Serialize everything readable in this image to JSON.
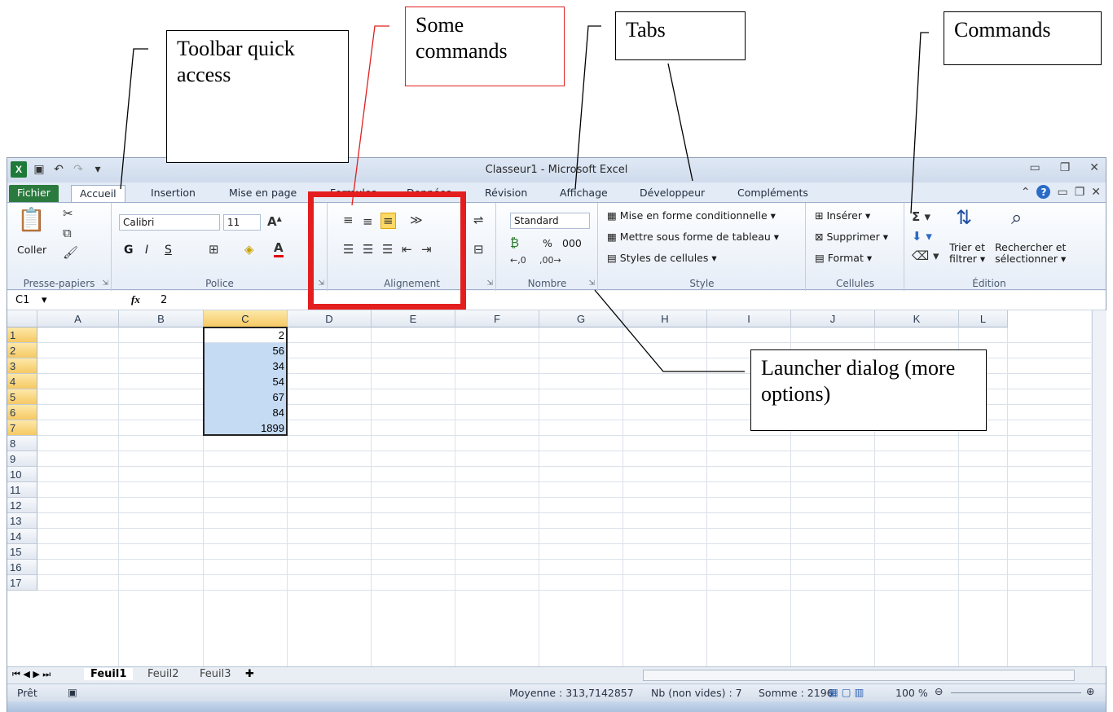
{
  "callouts": {
    "qat": "Toolbar quick access",
    "some_commands": "Some commands",
    "tabs": "Tabs",
    "commands": "Commands",
    "launcher": "Launcher dialog (more options)"
  },
  "titlebar": {
    "title": "Classeur1 - Microsoft Excel"
  },
  "tabs": [
    "Fichier",
    "Accueil",
    "Insertion",
    "Mise en page",
    "Formules",
    "Données",
    "Révision",
    "Affichage",
    "Développeur",
    "Compléments"
  ],
  "ribbon": {
    "paste": "Coller",
    "font_name": "Calibri",
    "font_size": "11",
    "bold": "G",
    "italic": "I",
    "underline": "S",
    "number_format": "Standard",
    "percent": "%",
    "thousands": "000",
    "cond_format": "Mise en forme conditionnelle",
    "as_table": "Mettre sous forme de tableau",
    "cell_styles": "Styles de cellules",
    "insert": "Insérer",
    "delete": "Supprimer",
    "format": "Format",
    "sort_filter_1": "Trier et",
    "sort_filter_2": "filtrer",
    "find_select_1": "Rechercher et",
    "find_select_2": "sélectionner",
    "groups": [
      "Presse-papiers",
      "Police",
      "Alignement",
      "Nombre",
      "Style",
      "Cellules",
      "Édition"
    ]
  },
  "formula_bar": {
    "name_box": "C1",
    "fx": "fx",
    "value": "2"
  },
  "grid": {
    "columns": [
      "A",
      "B",
      "C",
      "D",
      "E",
      "F",
      "G",
      "H",
      "I",
      "J",
      "K",
      "L"
    ],
    "rows": [
      "1",
      "2",
      "3",
      "4",
      "5",
      "6",
      "7",
      "8",
      "9",
      "10",
      "11",
      "12",
      "13",
      "14",
      "15",
      "16",
      "17"
    ],
    "selected_column": "C",
    "column_c_values": [
      "2",
      "56",
      "34",
      "54",
      "67",
      "84",
      "1899"
    ]
  },
  "sheets": [
    "Feuil1",
    "Feuil2",
    "Feuil3"
  ],
  "status": {
    "ready": "Prêt",
    "average": "Moyenne : 313,7142857",
    "count": "Nb (non vides) : 7",
    "sum": "Somme : 2196",
    "zoom": "100 %"
  },
  "colors": {
    "file_tab": "#2b7a3d",
    "highlight_box": "#e41e1e",
    "selection": "#c5dbf3"
  }
}
